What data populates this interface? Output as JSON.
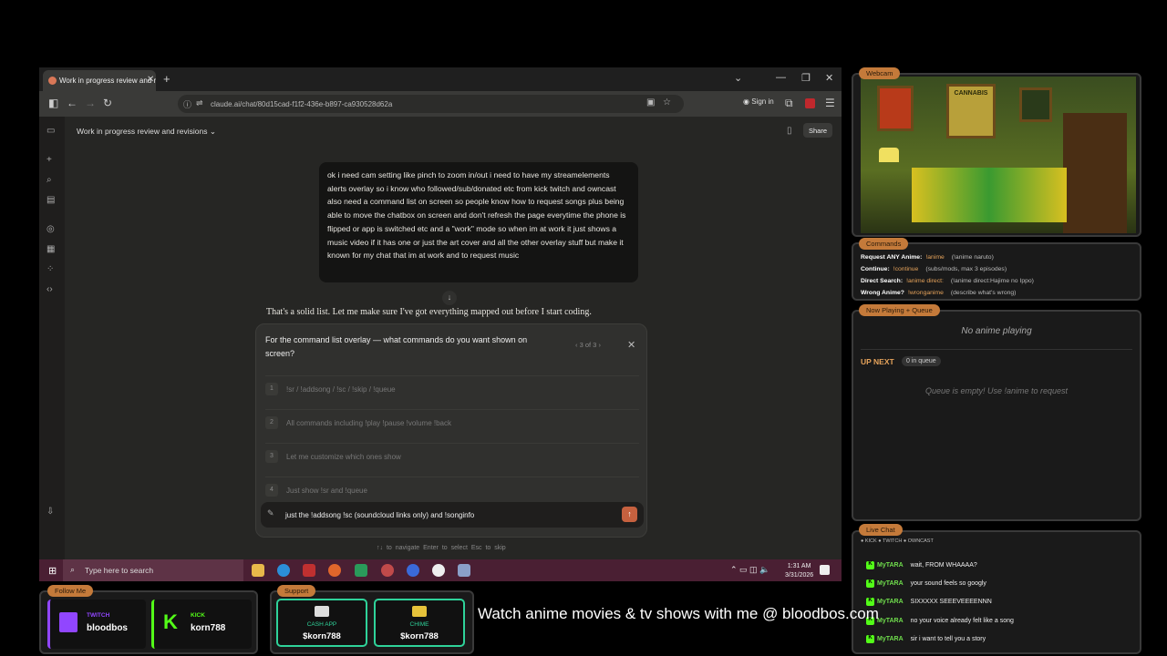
{
  "browser": {
    "tab_title": "Work in progress review and re",
    "url": "claude.ai/chat/80d15cad-f1f2-436e-b897-ca930528d62a",
    "sign_in": "Sign in"
  },
  "chat": {
    "title": "Work in progress review and revisions",
    "share_label": "Share",
    "user_message": "ok i need cam setting like pinch to zoom in/out i need to have my streamelements alerts overlay so i know who followed/sub/donated etc from kick twitch and owncast also need a command list on screen so people know how to request songs plus being able to move the chatbox on screen and don't refresh the page everytime the phone is flipped or app is switched etc and a \"work\" mode so when im at work it just shows a music video if it has one or just the art cover and all the other overlay stuff but make it known for my chat that im at work and to request music",
    "response": "That's a solid list. Let me make sure I've got everything mapped out before I start coding.",
    "question": "For the command list overlay — what commands do you want shown on screen?",
    "question_nav": "3 of 3",
    "options": [
      {
        "num": "1",
        "label": "!sr / !addsong / !sc / !skip / !queue"
      },
      {
        "num": "2",
        "label": "All commands including !play !pause !volume !back"
      },
      {
        "num": "3",
        "label": "Let me customize which ones show"
      },
      {
        "num": "4",
        "label": "Just show !sr and !queue"
      }
    ],
    "input_value": "just the !addsong !sc (soundcloud links only) and !songinfo",
    "hints": "↑↓ to navigate    Enter to select    Esc to skip",
    "avatar": "K"
  },
  "taskbar": {
    "search_placeholder": "Type here to search",
    "time": "1:31 AM",
    "date": "3/31/2026"
  },
  "overlay": {
    "webcam_label": "Webcam",
    "poster_text": "CANNABIS",
    "commands_label": "Commands",
    "commands": [
      {
        "name": "Request ANY Anime:",
        "cmd": "!anime",
        "desc": "(!anime naruto)"
      },
      {
        "name": "Continue:",
        "cmd": "!continue",
        "desc": "(subs/mods, max 3 episodes)"
      },
      {
        "name": "Direct Search:",
        "cmd": "!anime direct:",
        "desc": "(!anime direct:Hajime no Ippo)"
      },
      {
        "name": "Wrong Anime?",
        "cmd": "!wronganime",
        "desc": "(describe what's wrong)"
      }
    ],
    "now_playing_label": "Now Playing + Queue",
    "no_anime": "No anime playing",
    "up_next": "UP NEXT",
    "queue_count": "0 in queue",
    "queue_empty": "Queue is empty! Use !anime to request",
    "live_chat_label": "Live Chat",
    "chat_sources": "● KICK  ● TWITCH  ● OWNCAST",
    "chat_messages": [
      {
        "user": "MyTARA",
        "text": "wait, FROM WHAAAA?"
      },
      {
        "user": "MyTARA",
        "text": "your sound feels so googly"
      },
      {
        "user": "MyTARA",
        "text": "SIXXXXX SEEEVEEEENNN"
      },
      {
        "user": "MyTARA",
        "text": "no your voice already felt like a song"
      },
      {
        "user": "MyTARA",
        "text": "sir i want to tell you a story"
      }
    ],
    "follow_label": "Follow Me",
    "twitch_label": "TWITCH",
    "twitch_user": "bloodbos",
    "kick_label": "KICK",
    "kick_user": "korn788",
    "support_label": "Support",
    "cashapp_label": "CASH APP",
    "cashapp_user": "$korn788",
    "chime_label": "CHIME",
    "chime_user": "$korn788",
    "ticker": "Watch anime movies & tv shows with me @ bloodbos.com"
  }
}
